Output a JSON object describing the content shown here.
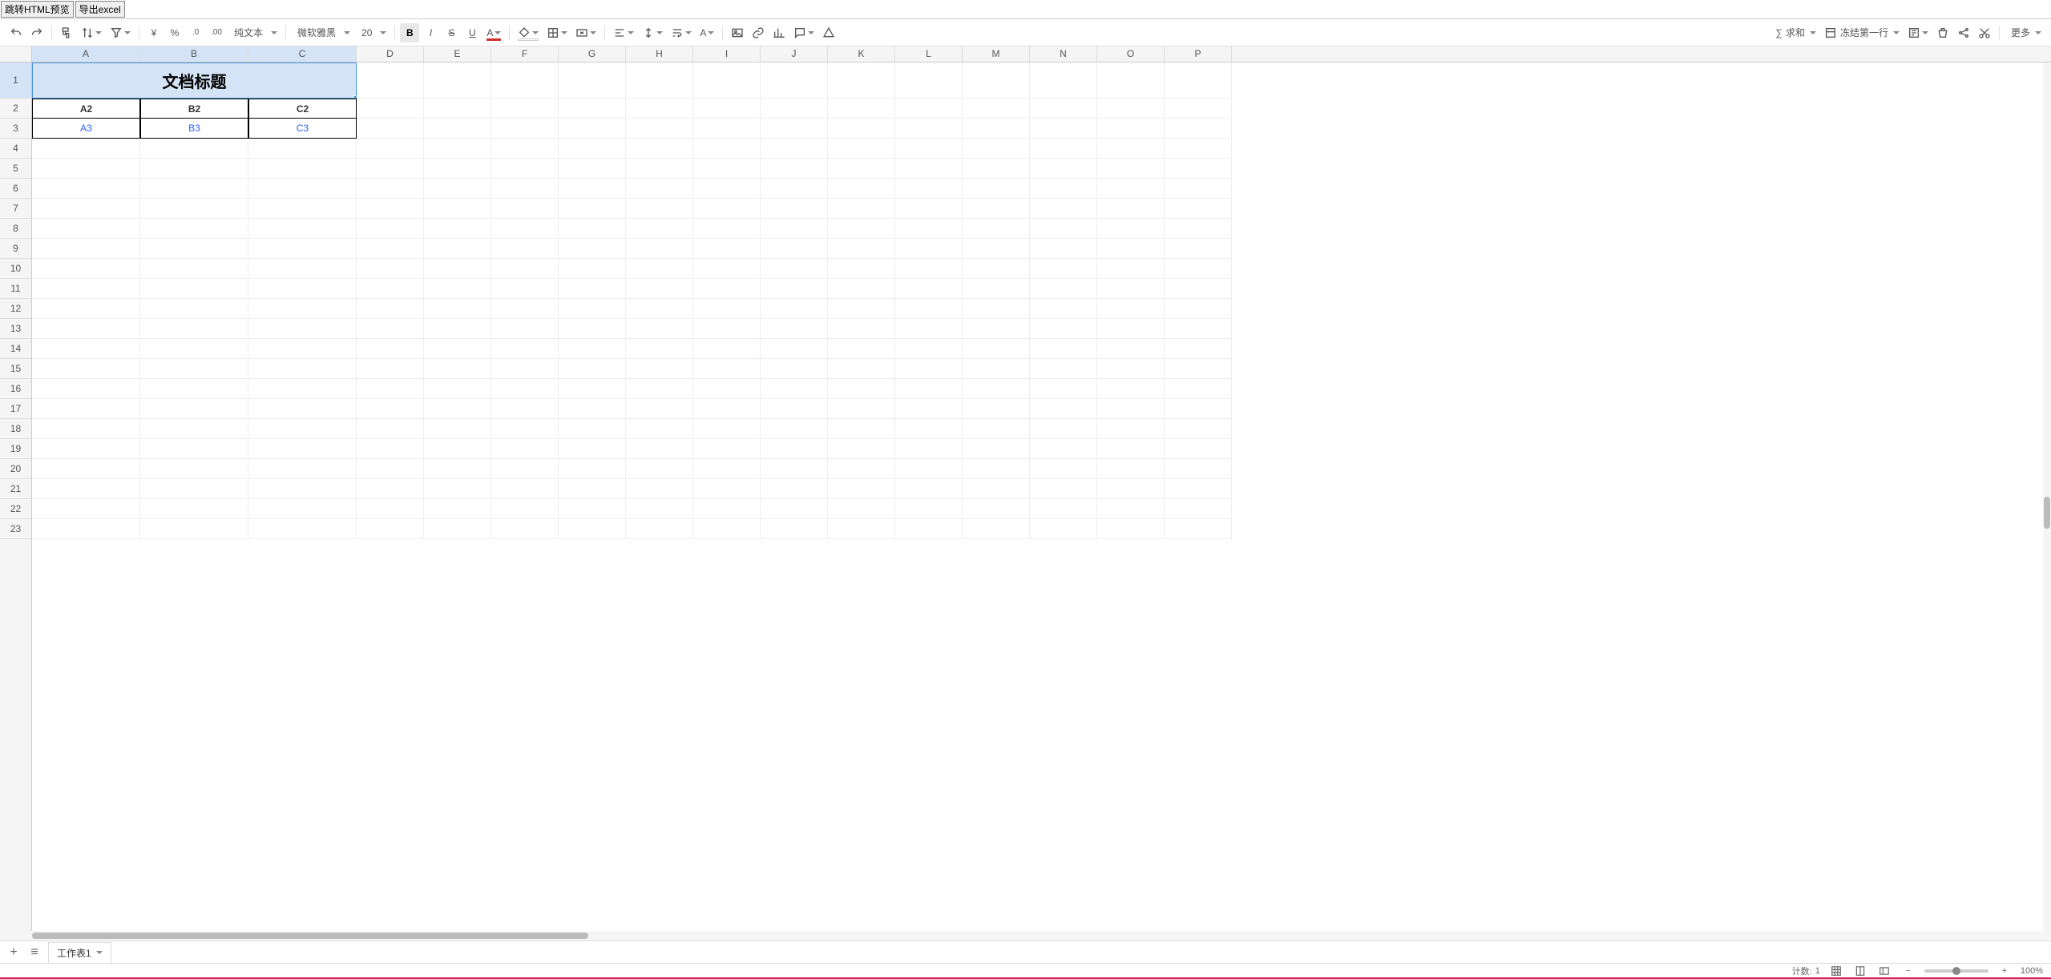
{
  "top_buttons": {
    "html_preview": "跳转HTML预览",
    "export_excel": "导出excel"
  },
  "toolbar": {
    "format_select": "纯文本",
    "font_select": "微软雅黑",
    "font_size": "20",
    "sum_label": "求和",
    "freeze_label": "冻结第一行",
    "more_label": "更多"
  },
  "columns": [
    "A",
    "B",
    "C",
    "D",
    "E",
    "F",
    "G",
    "H",
    "I",
    "J",
    "K",
    "L",
    "M",
    "N",
    "O",
    "P"
  ],
  "rows": [
    "1",
    "2",
    "3",
    "4",
    "5",
    "6",
    "7",
    "8",
    "9",
    "10",
    "11",
    "12",
    "13",
    "14",
    "15",
    "16",
    "17",
    "18",
    "19",
    "20",
    "21",
    "22",
    "23"
  ],
  "cells": {
    "title": "文档标题",
    "r2": {
      "a": "A2",
      "b": "B2",
      "c": "C2"
    },
    "r3": {
      "a": "A3",
      "b": "B3",
      "c": "C3"
    }
  },
  "sheet_tabs": {
    "tab1": "工作表1"
  },
  "status": {
    "count_label": "计数:",
    "count_value": "1",
    "zoom": "100%"
  }
}
